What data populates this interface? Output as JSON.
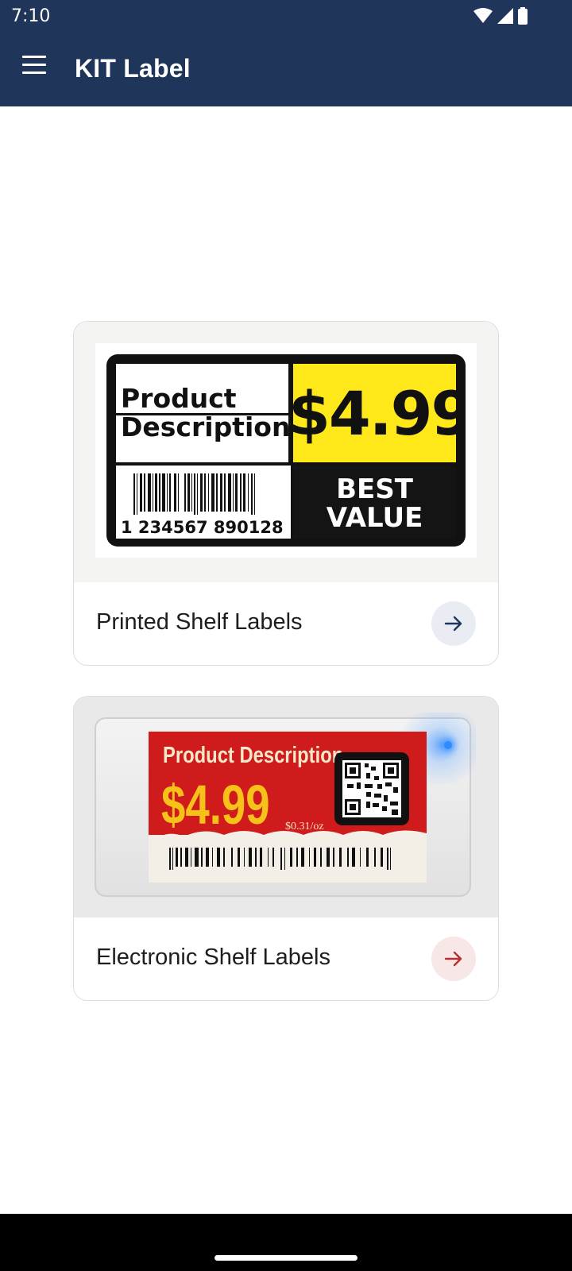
{
  "status_bar": {
    "time": "7:10",
    "icons": [
      "wifi-icon",
      "signal-icon",
      "battery-icon"
    ]
  },
  "app_bar": {
    "title": "KIT Label",
    "menu_icon": "hamburger-menu-icon",
    "background": "#1f3559"
  },
  "cards": [
    {
      "label": "Printed Shelf Labels",
      "arrow_icon": "arrow-right-icon",
      "arrow_bg": "#e9edf3",
      "arrow_color": "#1f3559",
      "art": {
        "description_line1": "Product",
        "description_line2": "Description",
        "price": "$4.99",
        "barcode_digits": "1 234567 890128 >",
        "badge_line1": "BEST",
        "badge_line2": "VALUE"
      }
    },
    {
      "label": "Electronic Shelf Labels",
      "arrow_icon": "arrow-right-icon",
      "arrow_bg": "#f8e7e7",
      "arrow_color": "#b43030",
      "art": {
        "description": "Product Description",
        "price": "$4.99",
        "unit_price": "$0.31/oz"
      }
    }
  ]
}
